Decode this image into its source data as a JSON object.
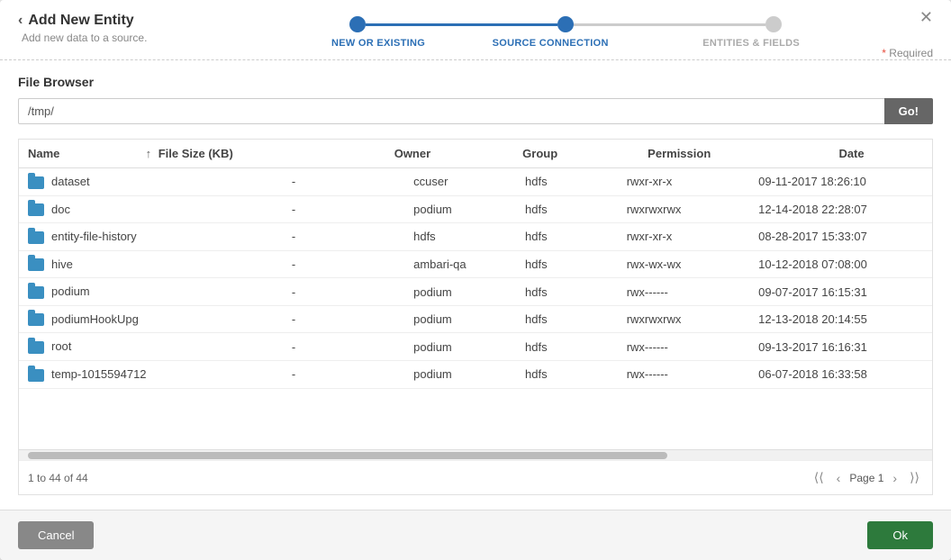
{
  "header": {
    "back_icon": "‹",
    "title": "Add New Entity",
    "subtitle": "Add new data to a source.",
    "close_icon": "✕",
    "required_label": "Required",
    "required_star": "*"
  },
  "stepper": {
    "steps": [
      {
        "label": "NEW OR EXISTING",
        "state": "done"
      },
      {
        "label": "SOURCE CONNECTION",
        "state": "active"
      },
      {
        "label": "ENTITIES & FIELDS",
        "state": "inactive"
      }
    ]
  },
  "file_browser": {
    "section_title": "File Browser",
    "path_value": "/tmp/",
    "path_placeholder": "/tmp/",
    "go_label": "Go!"
  },
  "table": {
    "columns": [
      {
        "key": "name",
        "label": "Name",
        "sortable": false
      },
      {
        "key": "filesize",
        "label": "File Size (KB)",
        "sortable": true,
        "sort_icon": "↑"
      },
      {
        "key": "owner",
        "label": "Owner",
        "sortable": false
      },
      {
        "key": "group",
        "label": "Group",
        "sortable": false
      },
      {
        "key": "permission",
        "label": "Permission",
        "sortable": false
      },
      {
        "key": "date",
        "label": "Date",
        "sortable": false
      }
    ],
    "rows": [
      {
        "name": "dataset",
        "filesize": "-",
        "owner": "ccuser",
        "group": "hdfs",
        "permission": "rwxr-xr-x",
        "date": "09-11-2017 18:26:10"
      },
      {
        "name": "doc",
        "filesize": "-",
        "owner": "podium",
        "group": "hdfs",
        "permission": "rwxrwxrwx",
        "date": "12-14-2018 22:28:07"
      },
      {
        "name": "entity-file-history",
        "filesize": "-",
        "owner": "hdfs",
        "group": "hdfs",
        "permission": "rwxr-xr-x",
        "date": "08-28-2017 15:33:07"
      },
      {
        "name": "hive",
        "filesize": "-",
        "owner": "ambari-qa",
        "group": "hdfs",
        "permission": "rwx-wx-wx",
        "date": "10-12-2018 07:08:00"
      },
      {
        "name": "podium",
        "filesize": "-",
        "owner": "podium",
        "group": "hdfs",
        "permission": "rwx------",
        "date": "09-07-2017 16:15:31"
      },
      {
        "name": "podiumHookUpg",
        "filesize": "-",
        "owner": "podium",
        "group": "hdfs",
        "permission": "rwxrwxrwx",
        "date": "12-13-2018 20:14:55"
      },
      {
        "name": "root",
        "filesize": "-",
        "owner": "podium",
        "group": "hdfs",
        "permission": "rwx------",
        "date": "09-13-2017 16:16:31"
      },
      {
        "name": "temp-1015594712",
        "filesize": "-",
        "owner": "podium",
        "group": "hdfs",
        "permission": "rwx------",
        "date": "06-07-2018 16:33:58"
      }
    ]
  },
  "pagination": {
    "summary": "1 to 44 of 44",
    "page_label": "Page 1",
    "first_icon": "⟨⟨",
    "prev_icon": "‹",
    "next_icon": "›",
    "last_icon": "⟩⟩"
  },
  "footer": {
    "cancel_label": "Cancel",
    "ok_label": "Ok"
  }
}
